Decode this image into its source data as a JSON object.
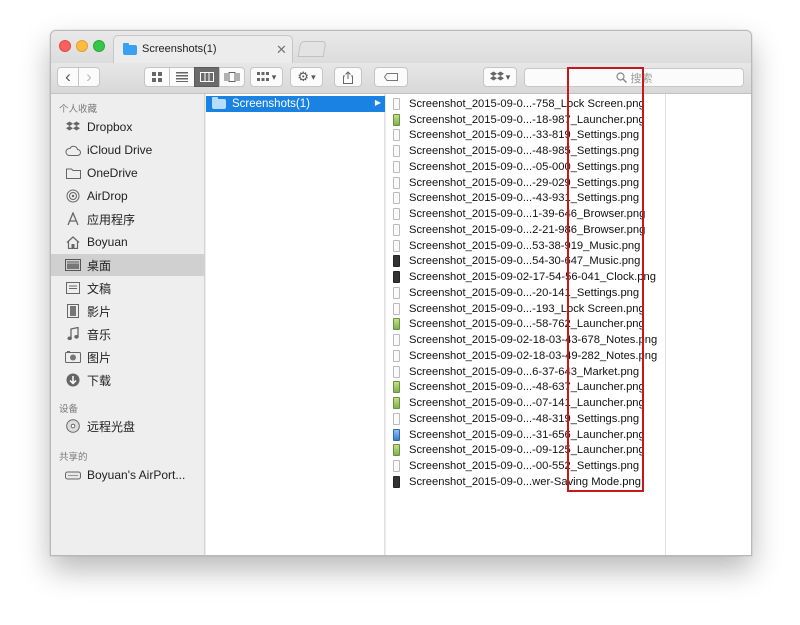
{
  "window": {
    "tab_title": "Screenshots(1)",
    "tab_close": "✕"
  },
  "toolbar": {
    "back": "‹",
    "forward": "›",
    "search_placeholder": "搜索",
    "search_icon": "magnifier-icon",
    "gear_glyph": "⚙",
    "dropdown_glyph": "▾"
  },
  "sidebar": {
    "favorites_header": "个人收藏",
    "favorites": [
      {
        "label": "Dropbox",
        "icon": "dropbox-icon"
      },
      {
        "label": "iCloud Drive",
        "icon": "cloud-icon"
      },
      {
        "label": "OneDrive",
        "icon": "folder-icon"
      },
      {
        "label": "AirDrop",
        "icon": "airdrop-icon"
      },
      {
        "label": "应用程序",
        "icon": "applications-icon"
      },
      {
        "label": "Boyuan",
        "icon": "home-icon"
      },
      {
        "label": "桌面",
        "icon": "desktop-icon",
        "selected": true
      },
      {
        "label": "文稿",
        "icon": "documents-icon"
      },
      {
        "label": "影片",
        "icon": "movies-icon"
      },
      {
        "label": "音乐",
        "icon": "music-icon"
      },
      {
        "label": "图片",
        "icon": "pictures-icon"
      },
      {
        "label": "下载",
        "icon": "downloads-icon"
      }
    ],
    "devices_header": "设备",
    "devices": [
      {
        "label": "远程光盘",
        "icon": "disc-icon"
      }
    ],
    "shared_header": "共享的",
    "shared": [
      {
        "label": "Boyuan's AirPort...",
        "icon": "airport-disk-icon"
      }
    ]
  },
  "column1": {
    "selected_folder": "Screenshots(1)",
    "arrow": "▶"
  },
  "files": [
    {
      "name": "Screenshot_2015-09-0...-758_Lock Screen.png",
      "thumb": "white"
    },
    {
      "name": "Screenshot_2015-09-0...-18-987_Launcher.png",
      "thumb": "green"
    },
    {
      "name": "Screenshot_2015-09-0...-33-819_Settings.png",
      "thumb": "white"
    },
    {
      "name": "Screenshot_2015-09-0...-48-985_Settings.png",
      "thumb": "white"
    },
    {
      "name": "Screenshot_2015-09-0...-05-000_Settings.png",
      "thumb": "white"
    },
    {
      "name": "Screenshot_2015-09-0...-29-029_Settings.png",
      "thumb": "white"
    },
    {
      "name": "Screenshot_2015-09-0...-43-931_Settings.png",
      "thumb": "white"
    },
    {
      "name": "Screenshot_2015-09-0...1-39-646_Browser.png",
      "thumb": "white"
    },
    {
      "name": "Screenshot_2015-09-0...2-21-986_Browser.png",
      "thumb": "white"
    },
    {
      "name": "Screenshot_2015-09-0...53-38-919_Music.png",
      "thumb": "white"
    },
    {
      "name": "Screenshot_2015-09-0...54-30-647_Music.png",
      "thumb": "dark"
    },
    {
      "name": "Screenshot_2015-09-02-17-54-56-041_Clock.png",
      "thumb": "dark"
    },
    {
      "name": "Screenshot_2015-09-0...-20-141_Settings.png",
      "thumb": "white"
    },
    {
      "name": "Screenshot_2015-09-0...-193_Lock Screen.png",
      "thumb": "white"
    },
    {
      "name": "Screenshot_2015-09-0...-58-762_Launcher.png",
      "thumb": "green"
    },
    {
      "name": "Screenshot_2015-09-02-18-03-43-678_Notes.png",
      "thumb": "white"
    },
    {
      "name": "Screenshot_2015-09-02-18-03-49-282_Notes.png",
      "thumb": "white"
    },
    {
      "name": "Screenshot_2015-09-0...6-37-643_Market.png",
      "thumb": "white"
    },
    {
      "name": "Screenshot_2015-09-0...-48-637_Launcher.png",
      "thumb": "green"
    },
    {
      "name": "Screenshot_2015-09-0...-07-141_Launcher.png",
      "thumb": "green"
    },
    {
      "name": "Screenshot_2015-09-0...-48-319_Settings.png",
      "thumb": "white"
    },
    {
      "name": "Screenshot_2015-09-0...-31-656_Launcher.png",
      "thumb": "blue"
    },
    {
      "name": "Screenshot_2015-09-0...-09-125_Launcher.png",
      "thumb": "green"
    },
    {
      "name": "Screenshot_2015-09-0...-00-552_Settings.png",
      "thumb": "white"
    },
    {
      "name": "Screenshot_2015-09-0...wer-Saving Mode.png",
      "thumb": "dark"
    }
  ],
  "colors": {
    "selection_blue": "#1a82e2",
    "highlight_red": "#c8161d",
    "sidebar_selected": "#d0d0d0"
  }
}
